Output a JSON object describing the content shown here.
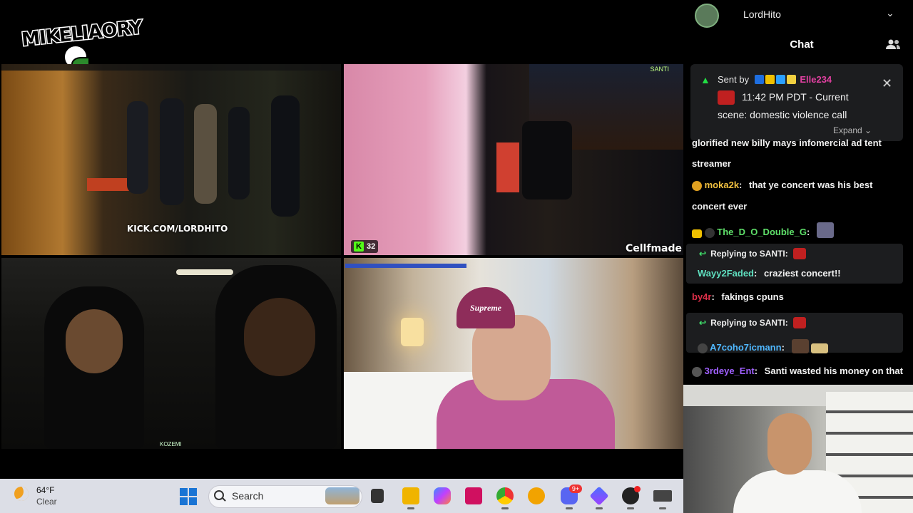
{
  "logo": {
    "text": "MIKELIAORY"
  },
  "streams": {
    "top_left_watermark": "KICK.COM/LORDHITO",
    "top_right_viewers": "32",
    "top_right_name": "Cellfmade",
    "top_right_tag": "SANTI",
    "bottom_left_tag": "KOZEMI",
    "bottom_right_cap_text": "Supreme"
  },
  "account": {
    "name": "LordHito"
  },
  "chat": {
    "title": "Chat",
    "pinned": {
      "sent_by_label": "Sent by",
      "sender": "Elle234",
      "line1": "11:42 PM PDT - Current",
      "line2": "scene: domestic violence call",
      "expand": "Expand"
    },
    "messages": [
      {
        "user": "",
        "text": "glorified new billy mays infomercial ad tent"
      },
      {
        "user": "",
        "text": "streamer"
      },
      {
        "user": "moka2k",
        "color": "#f0c040",
        "text": "that ye concert was his best"
      },
      {
        "user": "",
        "text": "concert ever"
      },
      {
        "user": "The_D_O_Double_G",
        "color": "#5fe06a",
        "text": ""
      },
      {
        "reply_label": "Replying to SANTI:",
        "user": "Wayy2Faded",
        "color": "#5fe0c0",
        "text": "craziest concert!!"
      },
      {
        "user": "by4r",
        "color": "#e0304a",
        "text": "fakings cpuns"
      },
      {
        "reply_label": "Replying to SANTI:",
        "user": "A7coho7icmann",
        "color": "#4fb8ff",
        "text": ""
      },
      {
        "user": "3rdeye_Ent",
        "color": "#a060ff",
        "text": "Santi wasted his money on that"
      }
    ]
  },
  "taskbar": {
    "weather_temp": "64°F",
    "weather_cond": "Clear",
    "search_placeholder": "Search",
    "discord_badge": "9+",
    "apps": [
      "file-explorer",
      "file-manager",
      "copilot",
      "picsart",
      "chrome",
      "sunny-app",
      "discord",
      "app-diamond",
      "obs",
      "app-extra"
    ]
  }
}
